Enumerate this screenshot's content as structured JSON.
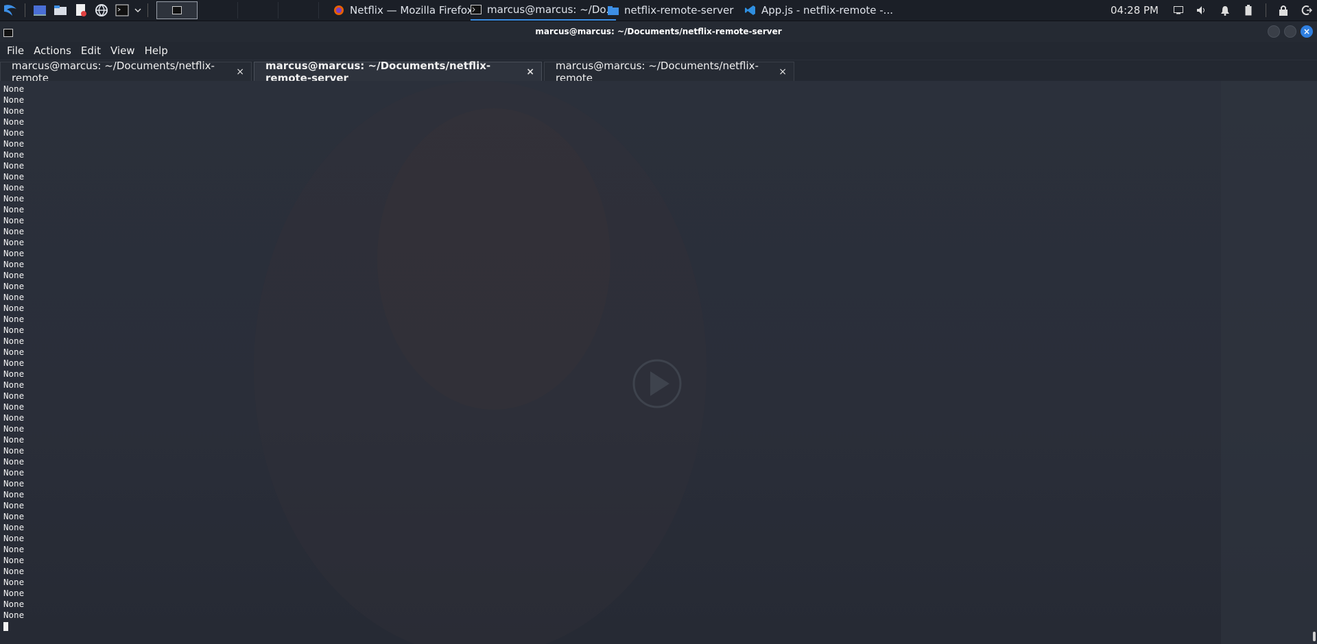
{
  "panel": {
    "tasks": [
      {
        "label": "Netflix — Mozilla Firefox",
        "icon": "firefox-icon"
      },
      {
        "label": "marcus@marcus: ~/Do...",
        "icon": "terminal-icon",
        "active": true
      },
      {
        "label": "netflix-remote-server",
        "icon": "folder-icon"
      },
      {
        "label": "App.js - netflix-remote -...",
        "icon": "vscode-icon"
      }
    ],
    "clock": "04:28 PM"
  },
  "window": {
    "title": "marcus@marcus: ~/Documents/netflix-remote-server"
  },
  "menu": [
    "File",
    "Actions",
    "Edit",
    "View",
    "Help"
  ],
  "tabs": [
    {
      "label": "marcus@marcus: ~/Documents/netflix-remote",
      "close": "×"
    },
    {
      "label": "marcus@marcus: ~/Documents/netflix-remote-server",
      "close": "×",
      "active": true
    },
    {
      "label": "marcus@marcus: ~/Documents/netflix-remote",
      "close": "×"
    }
  ],
  "terminal": {
    "line_text": "None",
    "line_count": 49
  },
  "colors": {
    "accent": "#3d8fe6",
    "panel_bg": "#1b1f27",
    "terminal_bg": "#2b303b"
  }
}
